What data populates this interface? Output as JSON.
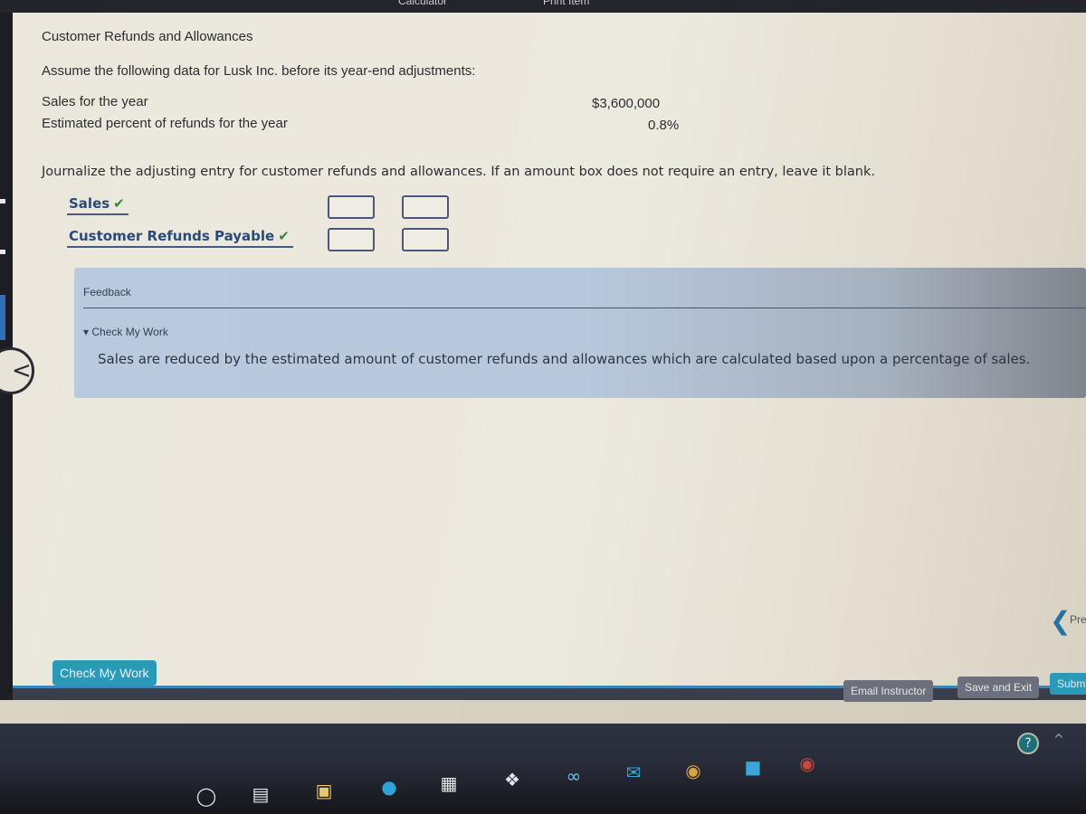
{
  "top_bar": {
    "links": [
      "Calculator",
      "Print Item"
    ]
  },
  "question": {
    "title": "Customer Refunds and Allowances",
    "intro": "Assume the following data for Lusk Inc. before its year-end adjustments:",
    "data_rows": [
      {
        "label": "Sales for the year",
        "value": "$3,600,000"
      },
      {
        "label": "Estimated percent of refunds for the year",
        "value": "0.8%"
      }
    ],
    "instruction": "Journalize the adjusting entry for customer refunds and allowances. If an amount box does not require an entry, leave it blank."
  },
  "journal": {
    "rows": [
      {
        "account": "Sales",
        "status": "correct",
        "debit": "",
        "credit": ""
      },
      {
        "account": "Customer Refunds Payable",
        "status": "correct",
        "debit": "",
        "credit": ""
      }
    ],
    "check_glyph": "✔"
  },
  "feedback": {
    "title": "Feedback",
    "toggle_label": "▾ Check My Work",
    "text": "Sales are reduced by the estimated amount of customer refunds and allowances which are calculated based upon a percentage of sales."
  },
  "navigation": {
    "previous_label": "Pre",
    "previous_side_glyph": "<"
  },
  "buttons": {
    "check_my_work": "Check My Work",
    "email_instructor": "Email Instructor",
    "save_and_exit": "Save and Exit",
    "submit": "Subm"
  },
  "taskbar": {
    "icons": [
      "search-icon",
      "task-view-icon",
      "file-explorer-icon",
      "edge-icon",
      "store-icon",
      "dropbox-icon",
      "infinity-app-icon",
      "mail-icon",
      "chrome-icon",
      "zoom-icon",
      "chrome-profile-icon"
    ],
    "help_glyph": "?",
    "tray_caret": "^"
  },
  "colors": {
    "accent_teal": "#2a9ab8",
    "account_blue": "#2a4a78",
    "check_green": "#2c8a3a",
    "feedback_bg": "#b9c9de"
  }
}
